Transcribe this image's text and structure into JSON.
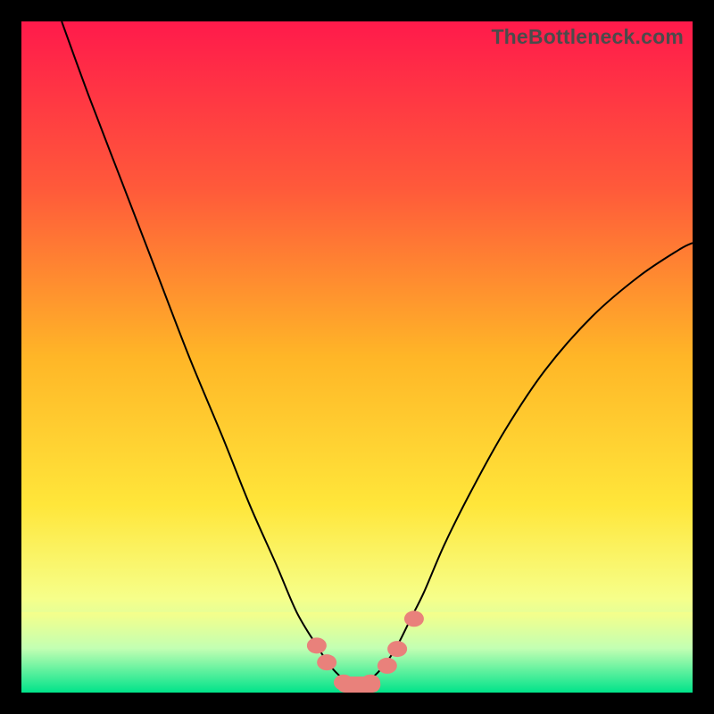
{
  "watermark": "TheBottleneck.com",
  "chart_data": {
    "type": "line",
    "title": "",
    "xlabel": "",
    "ylabel": "",
    "xlim": [
      0,
      100
    ],
    "ylim": [
      0,
      100
    ],
    "grid": false,
    "legend": false,
    "series": [
      {
        "name": "curve",
        "x": [
          6,
          10,
          15,
          20,
          25,
          30,
          34,
          38,
          41,
          44,
          46,
          48,
          50,
          52,
          54,
          56,
          58,
          60,
          63,
          67,
          72,
          78,
          85,
          92,
          98,
          100
        ],
        "y": [
          100,
          89,
          76,
          63,
          50,
          38,
          28,
          19,
          12,
          7,
          4,
          2,
          1,
          2,
          4,
          7,
          11,
          15,
          22,
          30,
          39,
          48,
          56,
          62,
          66,
          67
        ]
      }
    ],
    "markers": {
      "name": "highlight-dots",
      "points": [
        {
          "x": 44,
          "y": 7
        },
        {
          "x": 45.5,
          "y": 4.5
        },
        {
          "x": 48,
          "y": 1.5
        },
        {
          "x": 50,
          "y": 1
        },
        {
          "x": 52,
          "y": 1.5
        },
        {
          "x": 54.5,
          "y": 4
        },
        {
          "x": 56,
          "y": 6.5
        },
        {
          "x": 58.5,
          "y": 11
        }
      ]
    },
    "gradient": {
      "stops": [
        {
          "offset": 0.0,
          "color": "#ff1a4b"
        },
        {
          "offset": 0.25,
          "color": "#ff5a3a"
        },
        {
          "offset": 0.5,
          "color": "#ffb627"
        },
        {
          "offset": 0.72,
          "color": "#ffe63a"
        },
        {
          "offset": 0.86,
          "color": "#f6ff8a"
        },
        {
          "offset": 0.93,
          "color": "#c3ffb3"
        },
        {
          "offset": 1.0,
          "color": "#00e38a"
        }
      ]
    },
    "band": {
      "y_top": 12,
      "y_bottom": 0,
      "color_top": "#f6ff8a",
      "color_bottom": "#00e38a"
    }
  }
}
